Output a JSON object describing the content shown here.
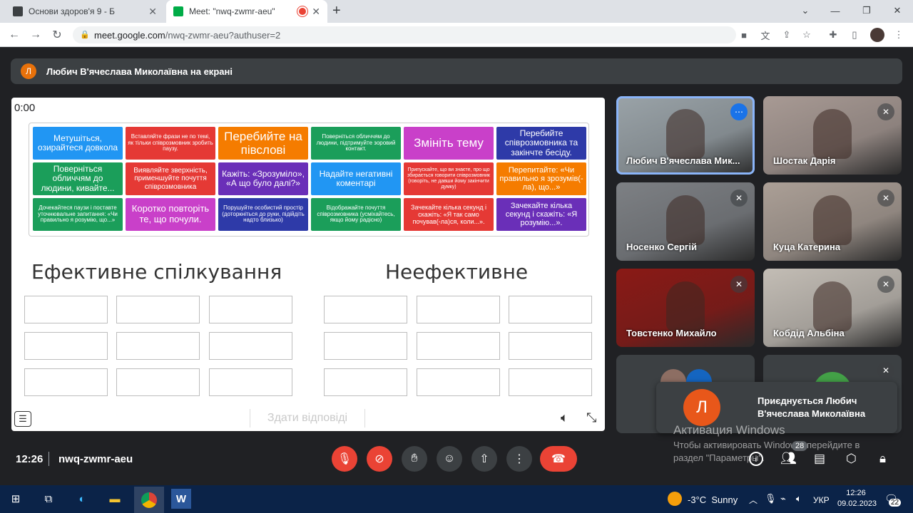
{
  "browser": {
    "tabs": [
      {
        "title": "Основи здоров'я 9 - Б",
        "favicon_color": "#3c4043"
      },
      {
        "title": "Meet: \"nwq-zwmr-aeu\"",
        "favicon_color": "#00ac47",
        "recording": true
      }
    ],
    "url_host": "meet.google.com",
    "url_path": "/nwq-zwmr-aeu?authuser=2"
  },
  "meet": {
    "presenter_avatar": "Л",
    "presenting_label": "Любич В'ячеслава Миколаївна на екрані",
    "time": "12:26",
    "meeting_code": "nwq-zwmr-aeu",
    "participant_count": "28"
  },
  "slide": {
    "timer": "0:00",
    "cards": [
      {
        "text": "Метушіться, озирайтеся довкола",
        "color": "#2196f3",
        "fs": 12
      },
      {
        "text": "Вставляйте фрази не по темі, як тільки співрозмовник зробить паузу.",
        "color": "#e53935",
        "fs": 8
      },
      {
        "text": "Перебийте на півслові",
        "color": "#f57c00",
        "fs": 17
      },
      {
        "text": "Поверніться обличчям до людини, підтримуйте зоровий контакт.",
        "color": "#1b9e5a",
        "fs": 8
      },
      {
        "text": "Змініть тему",
        "color": "#c940c9",
        "fs": 17
      },
      {
        "text": "Перебийте співрозмовника та закінчте бесіду.",
        "color": "#2e3aa8",
        "fs": 12
      },
      {
        "text": "Поверніться обличчям до людини, кивайте...",
        "color": "#1b9e5a",
        "fs": 12
      },
      {
        "text": "Виявляйте зверхність, применшуйте почуття співрозмовника",
        "color": "#e53935",
        "fs": 10
      },
      {
        "text": "Кажіть: «Зрозуміло», «А що було далі?»",
        "color": "#6a2fb8",
        "fs": 12
      },
      {
        "text": "Надайте негативні коментарі",
        "color": "#2196f3",
        "fs": 12
      },
      {
        "text": "Припускайте, що ви знаєте, про що збирається говорити співрозмовник (говоріть, не давши йому закінчити думку)",
        "color": "#e53935",
        "fs": 7
      },
      {
        "text": "Перепитайте: «Чи правильно я зрозумів(-ла), що...»",
        "color": "#f57c00",
        "fs": 11
      },
      {
        "text": "Дочекайтеся паузи і поставте уточнювальне запитання: «Чи правильно я розумію, що...»",
        "color": "#1b9e5a",
        "fs": 8
      },
      {
        "text": "Коротко повторіть те, що почули.",
        "color": "#c940c9",
        "fs": 13
      },
      {
        "text": "Порушуйте особистий простір (доторкніться до руки, підійдіть надто близько)",
        "color": "#2e3aa8",
        "fs": 8
      },
      {
        "text": "Відображайте почуття співрозмовника (усміхайтесь, якщо йому радісно)",
        "color": "#1b9e5a",
        "fs": 8
      },
      {
        "text": "Зачекайте кілька секунд і скажіть: «Я так само почував(-ла)ся, коли...».",
        "color": "#e53935",
        "fs": 9
      },
      {
        "text": "Зачекайте кілька секунд і скажіть: «Я розумію...».",
        "color": "#6a2fb8",
        "fs": 11
      }
    ],
    "heading_left": "Ефективне спілкування",
    "heading_right": "Неефективне",
    "submit_label": "Здати відповіді"
  },
  "participants": [
    {
      "name": "Любич В'ячеслава Мик...",
      "bg": "#9aa3a8",
      "muted": false,
      "active": true
    },
    {
      "name": "Шостак Дарія",
      "bg": "#a89a94",
      "muted": true
    },
    {
      "name": "Носенко Сергій",
      "bg": "#7d8084",
      "muted": true
    },
    {
      "name": "Куца Катерина",
      "bg": "#ab9f96",
      "muted": true
    },
    {
      "name": "Товстенко Михайло",
      "bg": "#8a1a16",
      "muted": true
    },
    {
      "name": "Кобдід Альбіна",
      "bg": "#c3bdb5",
      "muted": true
    }
  ],
  "toast": {
    "avatar": "Л",
    "text": "Приєднується Любич В'ячеслава Миколаївна"
  },
  "windows": {
    "activation_title": "Активация Windows",
    "activation_text": "Чтобы активировать Windows, перейдите в раздел \"Параметры\".",
    "weather": "-3°C  Sunny",
    "lang": "УКР",
    "clock_time": "12:26",
    "clock_date": "09.02.2023",
    "notif_count": "22"
  }
}
